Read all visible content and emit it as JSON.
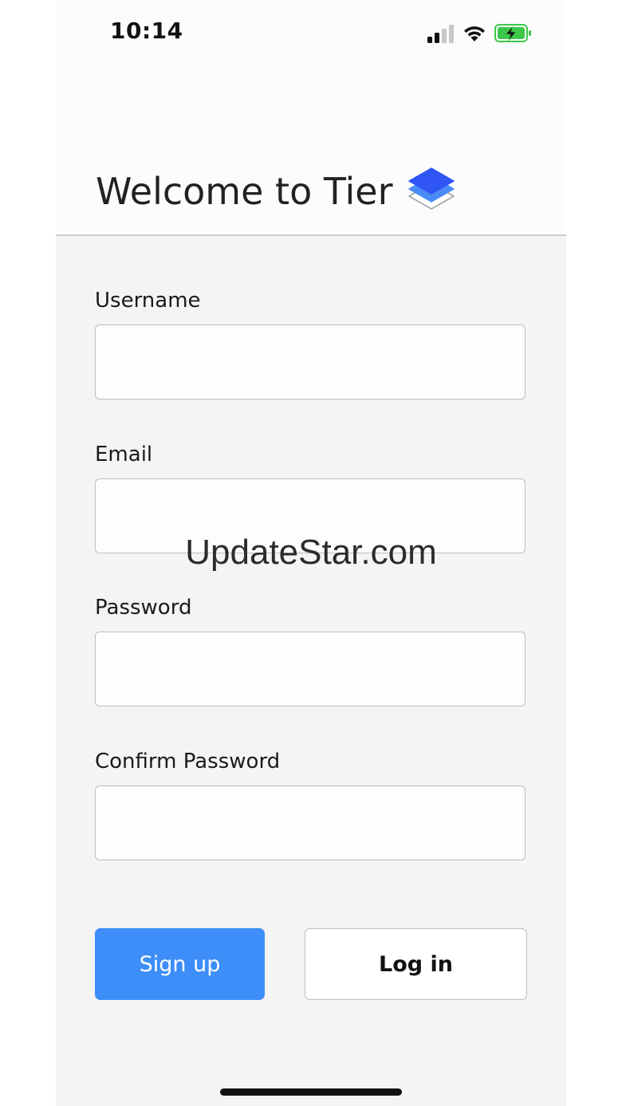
{
  "status_bar": {
    "time": "10:14",
    "icons": [
      "cellular-signal-icon",
      "wifi-icon",
      "battery-charging-icon"
    ],
    "battery_color": "#3cc84a"
  },
  "header": {
    "title": "Welcome to Tier",
    "logo_icon": "stacked-layers-logo",
    "logo_colors": [
      "#2f55f5",
      "#4a8cf7",
      "#ffffff"
    ]
  },
  "form": {
    "username": {
      "label": "Username",
      "value": "",
      "placeholder": ""
    },
    "email": {
      "label": "Email",
      "value": "",
      "placeholder": ""
    },
    "password": {
      "label": "Password",
      "value": "",
      "placeholder": ""
    },
    "confirm_password": {
      "label": "Confirm Password",
      "value": "",
      "placeholder": ""
    }
  },
  "actions": {
    "signup_label": "Sign up",
    "login_label": "Log in",
    "signup_color": "#3d8ef8"
  },
  "watermark": "UpdateStar.com"
}
